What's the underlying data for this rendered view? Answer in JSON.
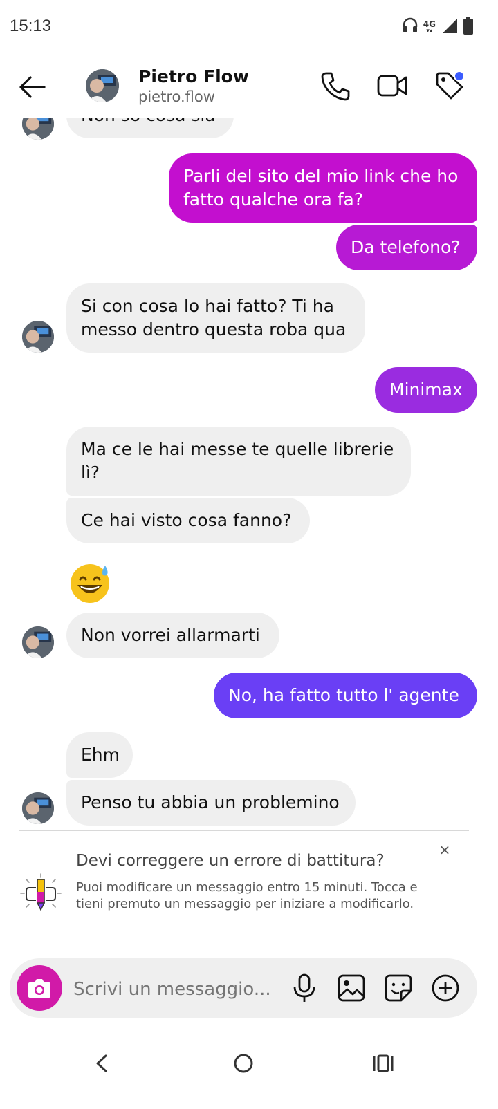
{
  "status_bar": {
    "time": "15:13",
    "network": "4G"
  },
  "header": {
    "name": "Pietro Flow",
    "username": "pietro.flow"
  },
  "messages": [
    {
      "side": "in",
      "text": "Non so cosa sia"
    },
    {
      "side": "out",
      "text": "Parli del sito del mio link che ho fatto qualche ora fa?"
    },
    {
      "side": "out",
      "text": "Da telefono?"
    },
    {
      "side": "in",
      "text": "Si con cosa lo hai fatto? Ti ha messo dentro questa roba qua"
    },
    {
      "side": "out",
      "text": "Minimax"
    },
    {
      "side": "in",
      "text": "Ma ce le hai messe te quelle librerie lì?"
    },
    {
      "side": "in",
      "text": "Ce hai visto cosa fanno?"
    },
    {
      "side": "in",
      "text": "😅"
    },
    {
      "side": "in",
      "text": "Non vorrei allarmarti"
    },
    {
      "side": "out",
      "text": "No, ha fatto tutto l' agente"
    },
    {
      "side": "in",
      "text": "Ehm"
    },
    {
      "side": "in",
      "text": "Penso tu abbia un problemino"
    }
  ],
  "tip": {
    "title": "Devi correggere un errore di battitura?",
    "body": "Puoi modificare un messaggio entro 15 minuti. Tocca e tieni premuto un messaggio per iniziare a modificarlo.",
    "close": "×"
  },
  "composer": {
    "placeholder": "Scrivi un messaggio..."
  },
  "colors": {
    "out_gradient_top": "#c30fcf",
    "out_gradient_mid": "#a02ae0",
    "out_gradient_bottom": "#6a3ff5",
    "in_bubble": "#efefef",
    "camera_button": "#d11aa8",
    "unread_dot": "#3b5cff"
  }
}
